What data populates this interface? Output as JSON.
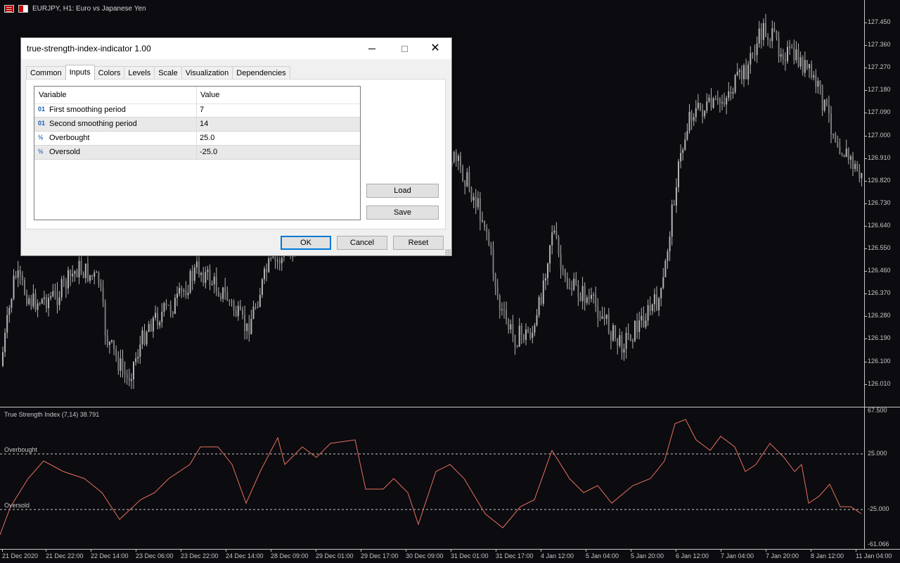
{
  "chart": {
    "title": "EURJPY, H1:  Euro vs Japanese Yen",
    "indicator_title": "True Strength Index (7,14) 38.791",
    "overbought_label": "Overbought",
    "oversold_label": "Oversold",
    "price_axis": [
      "127.450",
      "127.360",
      "127.270",
      "127.180",
      "127.090",
      "127.000",
      "126.910",
      "126.820",
      "126.730",
      "126.640",
      "126.550",
      "126.460",
      "126.370",
      "126.280",
      "126.190",
      "126.100",
      "126.010"
    ],
    "indicator_axis": [
      "67.500",
      "25.000",
      "-25.000",
      "-61.066"
    ],
    "time_axis": [
      "21 Dec 2020",
      "21 Dec 22:00",
      "22 Dec 14:00",
      "23 Dec 06:00",
      "23 Dec 22:00",
      "24 Dec 14:00",
      "28 Dec 09:00",
      "29 Dec 01:00",
      "29 Dec 17:00",
      "30 Dec 09:00",
      "31 Dec 01:00",
      "31 Dec 17:00",
      "4 Jan 12:00",
      "5 Jan 04:00",
      "5 Jan 20:00",
      "6 Jan 12:00",
      "7 Jan 04:00",
      "7 Jan 20:00",
      "8 Jan 12:00",
      "11 Jan 04:00"
    ],
    "colors": {
      "background": "#0b0b10",
      "candle": "#b4b4b4",
      "indicator_line": "#e8705c",
      "level_line": "#c8c8c8"
    }
  },
  "dialog": {
    "title": "true-strength-index-indicator 1.00",
    "tabs": [
      "Common",
      "Inputs",
      "Colors",
      "Levels",
      "Scale",
      "Visualization",
      "Dependencies"
    ],
    "active_tab": "Inputs",
    "columns": {
      "variable": "Variable",
      "value": "Value"
    },
    "inputs": [
      {
        "type": "01",
        "name": "First smoothing period",
        "value": "7"
      },
      {
        "type": "01",
        "name": "Second smoothing period",
        "value": "14"
      },
      {
        "type": "½",
        "name": "Overbought",
        "value": "25.0"
      },
      {
        "type": "½",
        "name": "Oversold",
        "value": "-25.0"
      }
    ],
    "buttons": {
      "load": "Load",
      "save": "Save",
      "ok": "OK",
      "cancel": "Cancel",
      "reset": "Reset"
    },
    "window_controls": {
      "minimize": "minimize-icon",
      "maximize": "maximize-icon",
      "close": "✕"
    }
  }
}
